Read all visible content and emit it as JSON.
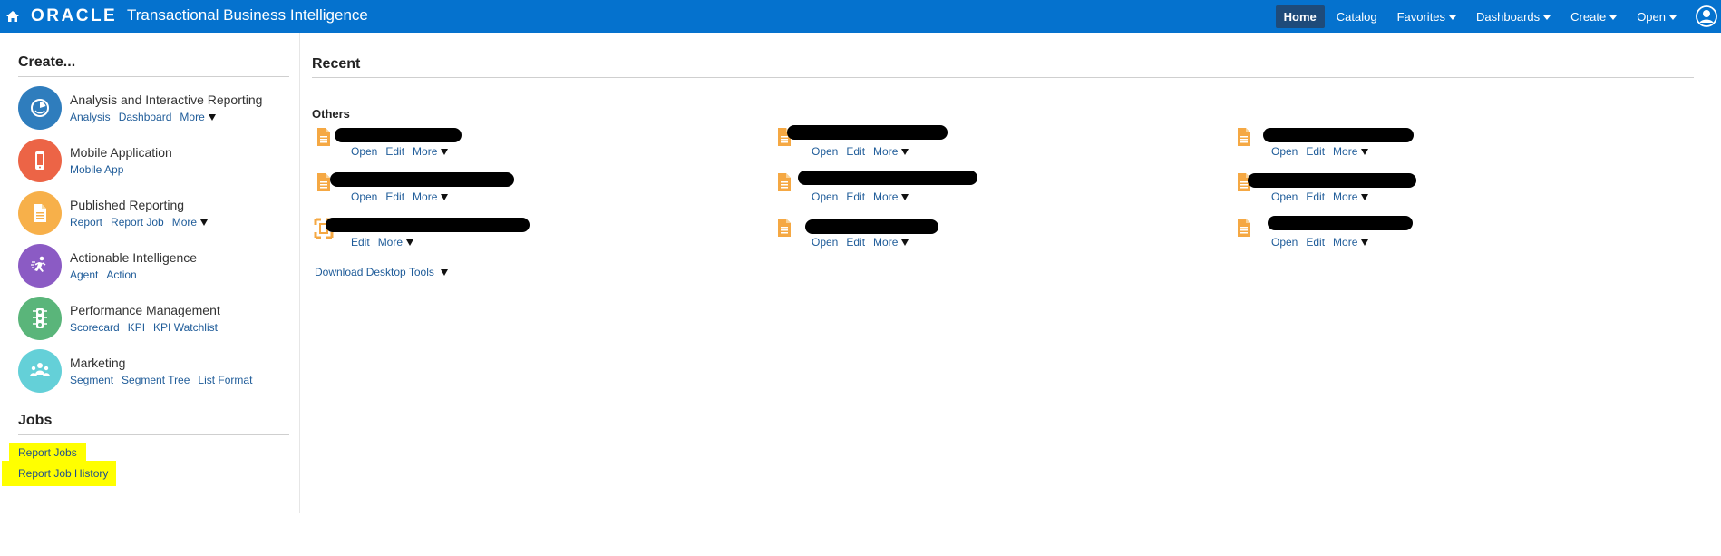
{
  "header": {
    "brand": "ORACLE",
    "app_title": "Transactional Business Intelligence",
    "nav": [
      {
        "label": "Home",
        "active": true,
        "dropdown": false
      },
      {
        "label": "Catalog",
        "active": false,
        "dropdown": false
      },
      {
        "label": "Favorites",
        "active": false,
        "dropdown": true
      },
      {
        "label": "Dashboards",
        "active": false,
        "dropdown": true
      },
      {
        "label": "Create",
        "active": false,
        "dropdown": true
      },
      {
        "label": "Open",
        "active": false,
        "dropdown": true
      }
    ],
    "colors": {
      "bar": "#0572ce",
      "active_tab": "#1e4b7a"
    }
  },
  "create": {
    "heading": "Create...",
    "items": [
      {
        "title": "Analysis and Interactive Reporting",
        "icon": "analysis-gauge-icon",
        "color": "#2f7dbd",
        "links": [
          "Analysis",
          "Dashboard",
          "More"
        ]
      },
      {
        "title": "Mobile Application",
        "icon": "mobile-phone-icon",
        "color": "#ec6446",
        "links": [
          "Mobile App"
        ]
      },
      {
        "title": "Published Reporting",
        "icon": "report-document-icon",
        "color": "#f7b04a",
        "links": [
          "Report",
          "Report Job",
          "More"
        ]
      },
      {
        "title": "Actionable Intelligence",
        "icon": "running-agent-icon",
        "color": "#8b5bc4",
        "links": [
          "Agent",
          "Action"
        ]
      },
      {
        "title": "Performance Management",
        "icon": "traffic-light-icon",
        "color": "#5ab57a",
        "links": [
          "Scorecard",
          "KPI",
          "KPI Watchlist"
        ]
      },
      {
        "title": "Marketing",
        "icon": "people-group-icon",
        "color": "#64d0d8",
        "links": [
          "Segment",
          "Segment Tree",
          "List Format"
        ]
      }
    ]
  },
  "jobs": {
    "heading": "Jobs",
    "links": [
      "Report Jobs",
      "Report Job History"
    ],
    "highlight_color": "#ffff00"
  },
  "recent": {
    "heading": "Recent",
    "subheading": "Others",
    "action_labels": {
      "open": "Open",
      "edit": "Edit",
      "more": "More"
    },
    "download_label": "Download Desktop Tools",
    "icon_color": "#f5a843"
  }
}
